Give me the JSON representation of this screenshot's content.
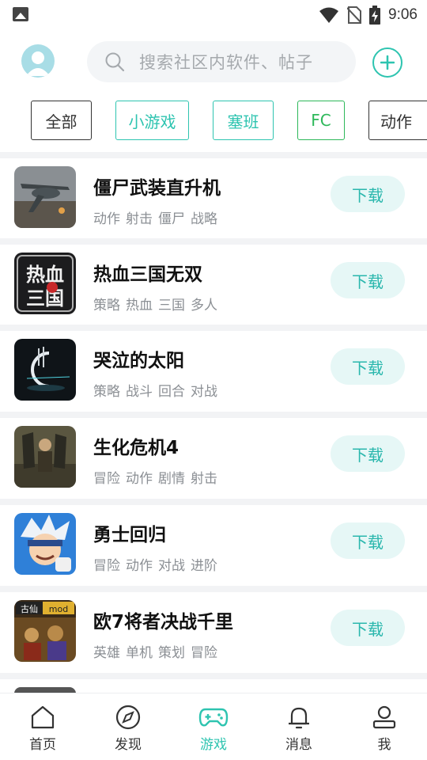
{
  "status_bar": {
    "time": "9:06",
    "icons": [
      "image-icon",
      "wifi-icon",
      "no-sim-icon",
      "battery-charging-icon"
    ]
  },
  "header": {
    "avatar_icon": "user-avatar-icon",
    "search_placeholder": "搜索社区内软件、帖子",
    "search_icon": "search-icon",
    "add_icon": "plus-circle-icon"
  },
  "categories": [
    {
      "label": "全部",
      "color": "#333333",
      "border": "#333333"
    },
    {
      "label": "小游戏",
      "color": "#2ec4b0",
      "border": "#2ec4b0"
    },
    {
      "label": "塞班",
      "color": "#2ec4b0",
      "border": "#2ec4b0"
    },
    {
      "label": "FC",
      "color": "#2db85a",
      "border": "#2db85a"
    },
    {
      "label": "动作",
      "color": "#333333",
      "border": "#333333"
    }
  ],
  "games": [
    {
      "title": "僵尸武装直升机",
      "tags": [
        "动作",
        "射击",
        "僵尸",
        "战略"
      ],
      "button": "下载"
    },
    {
      "title": "热血三国无双",
      "tags": [
        "策略",
        "热血",
        "三国",
        "多人"
      ],
      "button": "下载"
    },
    {
      "title": "哭泣的太阳",
      "tags": [
        "策略",
        "战斗",
        "回合",
        "对战"
      ],
      "button": "下载"
    },
    {
      "title": "生化危机4",
      "tags": [
        "冒险",
        "动作",
        "剧情",
        "射击"
      ],
      "button": "下载"
    },
    {
      "title": "勇士回归",
      "tags": [
        "冒险",
        "动作",
        "对战",
        "进阶"
      ],
      "button": "下载"
    },
    {
      "title": "欧7将者决战千里",
      "tags": [
        "英雄",
        "单机",
        "策划",
        "冒险"
      ],
      "button": "下载"
    }
  ],
  "game_icon_text": {
    "rexue_top": "热血",
    "rexue_bottom": "三国",
    "ou7_left": "古仙",
    "ou7_right": "mod"
  },
  "bottom_nav": [
    {
      "label": "首页",
      "icon": "home-icon",
      "active": false
    },
    {
      "label": "发现",
      "icon": "compass-icon",
      "active": false
    },
    {
      "label": "游戏",
      "icon": "gamepad-icon",
      "active": true
    },
    {
      "label": "消息",
      "icon": "bell-icon",
      "active": false
    },
    {
      "label": "我",
      "icon": "user-icon",
      "active": false
    }
  ],
  "colors": {
    "accent": "#2ec4b0",
    "download_bg": "#e6f7f6",
    "download_text": "#2ab7ad"
  }
}
